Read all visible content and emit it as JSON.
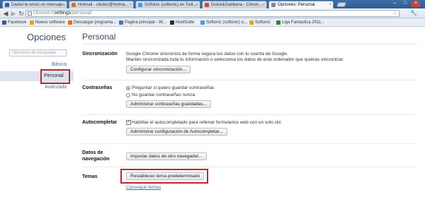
{
  "browser": {
    "tabs": [
      {
        "label": "Daniel te envió un mensaje...",
        "favicon_color": "#3b5998",
        "active": false
      },
      {
        "label": "Hotmail - c4ubcr@hotma...",
        "favicon_color": "#e56d1c",
        "active": false
      },
      {
        "label": "Softonic (softonic) en Twit...",
        "favicon_color": "#3ea3d8",
        "active": false
      },
      {
        "label": "Dolce&Gabbana - Chrom...",
        "favicon_color": "#d04a2a",
        "active": false
      },
      {
        "label": "Opciones: Personal",
        "favicon_color": "#7a8796",
        "active": true
      }
    ],
    "address": {
      "scheme": "chrome://",
      "path": "settings",
      "rest": "/personal"
    },
    "bookmarks": [
      {
        "label": "Facebook",
        "color": "#3b5998"
      },
      {
        "label": "Nuevo software",
        "color": "#e1a522"
      },
      {
        "label": "Descargar programa...",
        "color": "#e56d1c"
      },
      {
        "label": "Pagina principal - W...",
        "color": "#4a75b8"
      },
      {
        "label": "HootSuite",
        "color": "#2f2f2f"
      },
      {
        "label": "Softonic (softonic) o...",
        "color": "#3ea3d8"
      },
      {
        "label": "Softonic",
        "color": "#e1a522"
      },
      {
        "label": "Liga Fantastica 2011...",
        "color": "#2a8a3b"
      }
    ]
  },
  "sidebar": {
    "title": "Opciones",
    "search_placeholder": "Opciones de búsqueda",
    "items": {
      "basic": "Básica",
      "personal": "Personal",
      "advanced": "Avanzada"
    }
  },
  "main": {
    "title": "Personal",
    "sync": {
      "label": "Sincronización",
      "line1": "Google Chrome sincroniza de forma segura tus datos con tu cuenta de Google.",
      "line2": "Mantén sincronizada toda tu información o selecciona los datos de este ordenador que quieras sincronizar.",
      "button": "Configurar sincronización..."
    },
    "passwords": {
      "label": "Contraseñas",
      "option_ask": "Preguntar si quiero guardar contraseñas",
      "option_never": "No guardar contraseñas nunca",
      "button": "Administrar contraseñas guardadas..."
    },
    "autofill": {
      "label": "Autocompletar",
      "checkbox": "Habilitar el autocompletado para rellenar formularios web con un solo clic",
      "button": "Administrar configuración de Autocompletar..."
    },
    "browsing_data": {
      "label": "Datos de navegación",
      "button": "Importar datos de otro navegador..."
    },
    "themes": {
      "label": "Temas",
      "button": "Restablecer tema predeterminado",
      "link": "Conseguir temas"
    }
  }
}
